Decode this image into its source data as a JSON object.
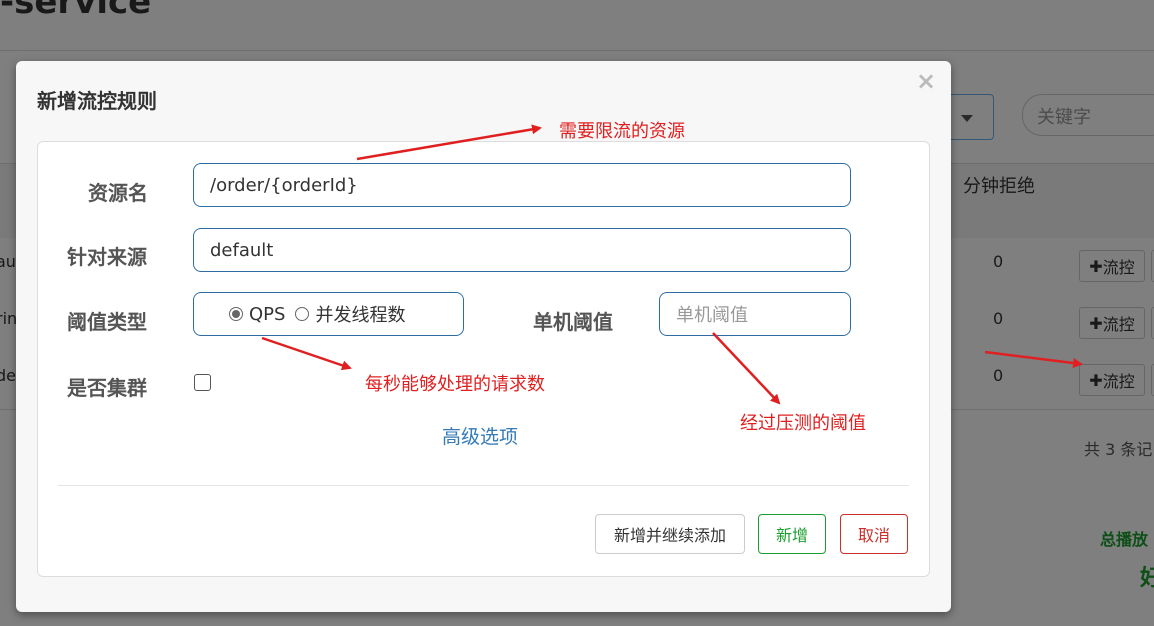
{
  "background": {
    "title": "-service",
    "keyword_placeholder": "关键字",
    "column_header": "分钟拒绝",
    "rows": [
      {
        "left_fragment": "au",
        "value": "0",
        "action": "流控"
      },
      {
        "left_fragment": "rin",
        "value": "0",
        "action": "流控"
      },
      {
        "left_fragment": "de",
        "value": "0",
        "action": "流控"
      }
    ],
    "total_text": "共 3 条记",
    "green_text_1": "总播放",
    "green_text_2": "好"
  },
  "modal": {
    "title": "新增流控规则",
    "close_glyph": "×",
    "fields": {
      "resource_label": "资源名",
      "resource_value": "/order/{orderId}",
      "origin_label": "针对来源",
      "origin_value": "default",
      "threshold_type_label": "阈值类型",
      "threshold_type_options": [
        "QPS",
        "并发线程数"
      ],
      "threshold_type_selected": "QPS",
      "single_threshold_label": "单机阈值",
      "single_threshold_placeholder": "单机阈值",
      "cluster_label": "是否集群"
    },
    "advanced_link": "高级选项",
    "buttons": {
      "add_continue": "新增并继续添加",
      "add": "新增",
      "cancel": "取消"
    }
  },
  "annotations": {
    "resource_note": "需要限流的资源",
    "qps_note": "每秒能够处理的请求数",
    "threshold_note": "经过压测的阈值"
  },
  "colors": {
    "annotation_red": "#e02020",
    "input_border": "#2e6da4",
    "link_blue": "#337ab7",
    "success_green": "#1a9e2e",
    "danger_red": "#c9302c"
  }
}
